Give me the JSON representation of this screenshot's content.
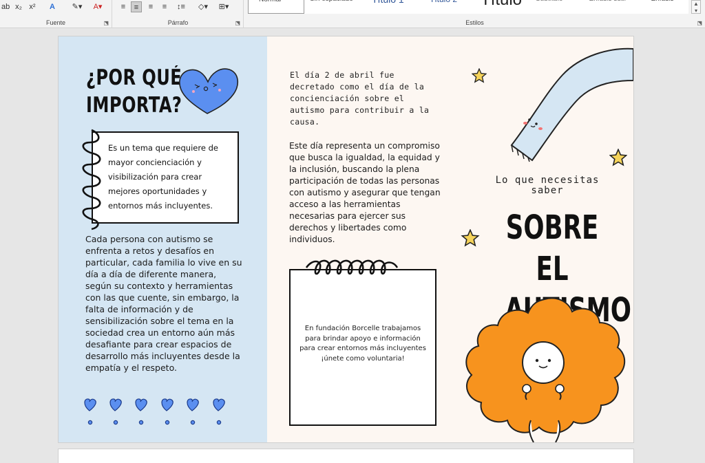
{
  "ribbon": {
    "fuente_label": "Fuente",
    "parrafo_label": "Párrafo",
    "estilos_label": "Estilos",
    "styles": [
      "Normal",
      "Sin espaciado",
      "Título 1",
      "Título 2",
      "Título",
      "Subtítulo",
      "Énfasis sutil",
      "Énfasis"
    ]
  },
  "left": {
    "title_line1": "¿POR QUÉ",
    "title_line2": "IMPORTA?",
    "note": "Es un tema que requiere de mayor concienciación y visibilización para crear mejores oportunidades y entornos más incluyentes.",
    "body": "Cada persona con autismo se enfrenta a retos y desafíos en particular, cada familia lo vive en su día a día de diferente manera, según su contexto y herramientas con las que cuente, sin embargo, la falta de información y de sensibilización sobre el tema en la sociedad crea un entorno aún más desafiante para crear espacios de desarrollo más incluyentes desde la empatía y el respeto."
  },
  "middle": {
    "intro": "El día 2 de abril fue decretado como el día de la concienciación sobre el autismo para contribuir a la causa.",
    "body": "Este día representa un compromiso que busca la igualdad, la equidad y la inclusión, buscando la plena participación de todas las personas con autismo y asegurar que tengan acceso a las herramientas necesarias para ejercer sus derechos y libertades como individuos.",
    "card_line1": "En fundación Borcelle trabajamos para brindar apoyo e información para crear entornos más incluyentes",
    "card_line2": "¡únete como voluntaria!"
  },
  "right": {
    "subtitle": "Lo que necesitas saber",
    "title_line1": "SOBRE EL",
    "title_line2": "AUTISMO"
  },
  "colors": {
    "left_panel": "#d5e6f3",
    "page": "#fdf7f2",
    "heart_blue": "#5b8ff0",
    "flower_orange": "#f7931e",
    "star_yellow": "#f5d35a"
  }
}
